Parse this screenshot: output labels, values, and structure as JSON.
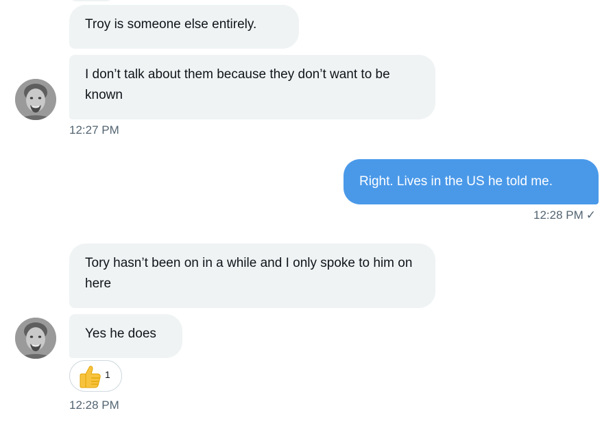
{
  "conversation": {
    "messages": [
      {
        "text": "Troy is someone else entirely."
      },
      {
        "text": "I don’t talk about them because they don’t want to be known"
      },
      {
        "text": "Right. Lives in the US he told me."
      },
      {
        "text": "Tory hasn’t been on in a while and I only spoke to him on here"
      },
      {
        "text": "Yes he does"
      }
    ],
    "timestamps": {
      "first_group": "12:27 PM",
      "sent": "12:28 PM",
      "second_group": "12:28 PM"
    },
    "sent_status": "✓",
    "reaction": {
      "emoji_name": "thumbs-up",
      "count": "1"
    }
  },
  "colors": {
    "incoming_bubble": "#eff3f4",
    "outgoing_bubble": "#4a99e9",
    "timestamp": "#536471"
  }
}
